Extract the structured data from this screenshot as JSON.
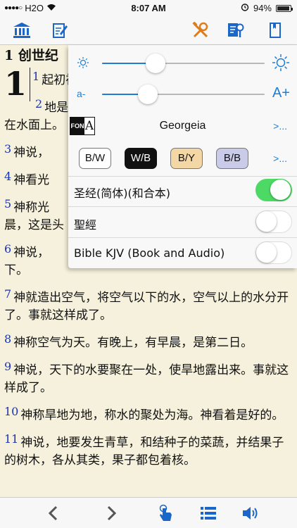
{
  "status_bar": {
    "carrier": "H2O",
    "time": "8:07 AM",
    "battery_percent": "94%",
    "battery_level": 0.94
  },
  "nav_bar": {
    "icons": [
      "library-icon",
      "notes-icon",
      "tools-icon",
      "search-index-icon",
      "bookmark-icon"
    ]
  },
  "reader": {
    "book_title": "1 创世纪",
    "drop_cap": "1",
    "verses": [
      {
        "num": "1",
        "text": "起初神"
      },
      {
        "num": "2",
        "text": "地是"
      },
      {
        "num": "",
        "text": "在水面上。"
      },
      {
        "num": "3",
        "text": "神说，"
      },
      {
        "num": "4",
        "text": "神看光"
      },
      {
        "num": "5",
        "text": "神称光"
      },
      {
        "num": "",
        "text": "晨，这是头"
      },
      {
        "num": "6",
        "text": "神说，"
      },
      {
        "num": "",
        "text": "下。"
      },
      {
        "num": "7",
        "text": "神就造出空气，将空气以下的水，空气以上的水分开了。事就这样成了。"
      },
      {
        "num": "8",
        "text": "神称空气为天。有晚上，有早晨，是第二日。"
      },
      {
        "num": "9",
        "text": "神说，天下的水要聚在一处，使旱地露出来。事就这样成了。"
      },
      {
        "num": "10",
        "text": "神称旱地为地，称水的聚处为海。神看着是好的。"
      },
      {
        "num": "11",
        "text": "神说，地要发生青草，和结种子的菜蔬，并结果子的树木，各从其类，果子都包着核。"
      }
    ]
  },
  "settings": {
    "brightness": {
      "level": 0.33,
      "low_icon": "sun-small-icon",
      "high_icon": "sun-large-icon"
    },
    "font_size": {
      "level": 0.28,
      "small_label": "a-",
      "large_label": "A+"
    },
    "font": {
      "logo_text_1": "FON",
      "logo_text_2": "A",
      "name": "Georgeia",
      "more_label": ">..."
    },
    "themes": [
      {
        "label": "B/W",
        "bg": "#ffffff",
        "fg": "#111111",
        "selected": false
      },
      {
        "label": "W/B",
        "bg": "#111111",
        "fg": "#ffffff",
        "selected": true
      },
      {
        "label": "B/Y",
        "bg": "#f3d8a6",
        "fg": "#111111",
        "selected": false
      },
      {
        "label": "B/B",
        "bg": "#c9cbe8",
        "fg": "#111111",
        "selected": false
      }
    ],
    "themes_more_label": ">...",
    "bibles": [
      {
        "label": "圣经(简体)(和合本)",
        "on": true
      },
      {
        "label": "聖經",
        "on": false
      },
      {
        "label": "Bible KJV (Book and Audio)",
        "on": false
      }
    ]
  },
  "toolbar": {
    "icons": [
      "chevron-left-icon",
      "chevron-right-icon",
      "tap-gesture-icon",
      "list-icon",
      "speaker-icon"
    ]
  },
  "colors": {
    "accent": "#1c7ed6",
    "toggle_on": "#4cd964",
    "page_bg": "#f5f1dc",
    "verse_number": "#1a33b5"
  }
}
